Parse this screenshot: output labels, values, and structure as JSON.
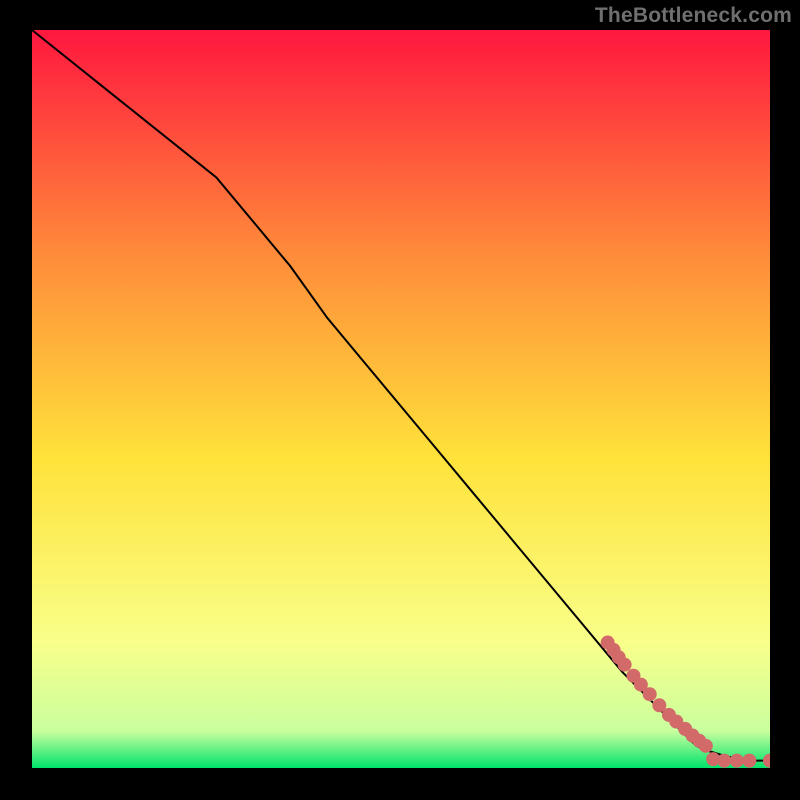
{
  "watermark": "TheBottleneck.com",
  "chart_data": {
    "type": "line",
    "title": "",
    "xlabel": "",
    "ylabel": "",
    "xlim": [
      0,
      100
    ],
    "ylim": [
      0,
      100
    ],
    "grid": false,
    "gradient": {
      "top_color": "#ff173f",
      "upper_mid_color": "#ff8a3a",
      "mid_color": "#ffe23a",
      "lower_mid_color": "#f9ff8a",
      "near_bottom_color": "#c9ff9e",
      "bottom_color": "#00e36b"
    },
    "series": [
      {
        "name": "curve",
        "type": "line",
        "color": "#000000",
        "x": [
          0,
          5,
          10,
          15,
          20,
          25,
          30,
          35,
          40,
          45,
          50,
          55,
          60,
          65,
          70,
          75,
          80,
          83,
          86,
          88,
          90,
          92,
          94,
          96,
          98,
          100,
          100
        ],
        "y": [
          100,
          96,
          92,
          88,
          84,
          80,
          74,
          68,
          61,
          55,
          49,
          43,
          37,
          31,
          25,
          19,
          13,
          10,
          7,
          5,
          3,
          2.2,
          1.6,
          1.2,
          1.0,
          1.0,
          1.0
        ]
      },
      {
        "name": "points-on-curve",
        "type": "scatter",
        "color": "#d26a6a",
        "radius": 7,
        "x": [
          78.0,
          78.8,
          79.5,
          80.3,
          81.5,
          82.5,
          83.7,
          85.0,
          86.3,
          87.3,
          88.5,
          89.5,
          90.4,
          91.3
        ],
        "y": [
          17.0,
          16.0,
          15.0,
          14.0,
          12.5,
          11.3,
          10.0,
          8.5,
          7.2,
          6.3,
          5.3,
          4.4,
          3.7,
          3.0
        ]
      },
      {
        "name": "points-tail",
        "type": "scatter",
        "color": "#d26a6a",
        "radius": 7,
        "x": [
          92.3,
          93.8,
          95.5,
          97.2,
          100.0
        ],
        "y": [
          1.2,
          1.0,
          1.0,
          1.0,
          1.0
        ]
      }
    ]
  }
}
